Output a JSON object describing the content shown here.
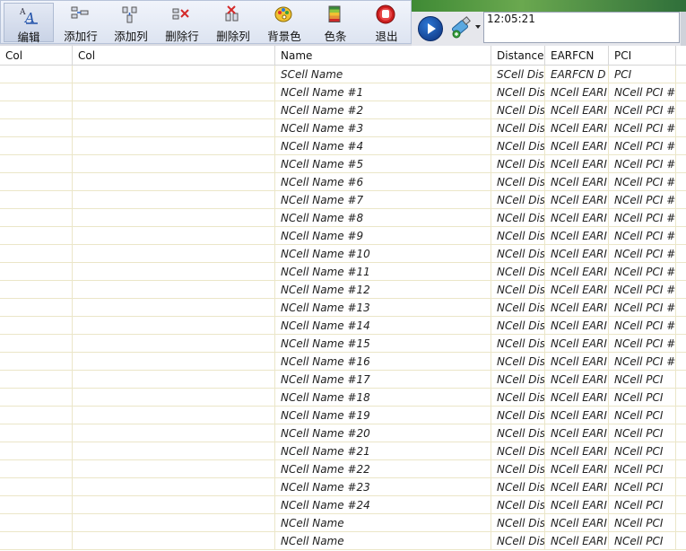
{
  "toolbar": {
    "buttons": [
      {
        "label": "编辑",
        "icon": "edit-text-icon"
      },
      {
        "label": "添加行",
        "icon": "add-row-icon"
      },
      {
        "label": "添加列",
        "icon": "add-column-icon"
      },
      {
        "label": "删除行",
        "icon": "delete-row-icon"
      },
      {
        "label": "删除列",
        "icon": "delete-column-icon"
      },
      {
        "label": "背景色",
        "icon": "palette-icon"
      },
      {
        "label": "色条",
        "icon": "color-bar-icon"
      },
      {
        "label": "退出",
        "icon": "stop-exit-icon"
      }
    ]
  },
  "status": {
    "clock": "12:05:21",
    "play_icon": "play-icon",
    "usb_icon": "usb-device-icon"
  },
  "colors": {
    "toolbar_bg": "#e4e9f4",
    "grid_line": "#ebe6c8",
    "play_blue": "#1a4fb0"
  },
  "table": {
    "headers": [
      "Col",
      "Col",
      "Name",
      "Distance",
      "EARFCN",
      "PCI"
    ],
    "rows": [
      [
        "",
        "",
        "SCell Name",
        "SCell Dis",
        "EARFCN D",
        "PCI"
      ],
      [
        "",
        "",
        "NCell Name #1",
        "NCell Dis",
        "NCell EARI",
        "NCell PCI #"
      ],
      [
        "",
        "",
        "NCell Name #2",
        "NCell Dis",
        "NCell EARI",
        "NCell PCI #"
      ],
      [
        "",
        "",
        "NCell Name #3",
        "NCell Dis",
        "NCell EARI",
        "NCell PCI #"
      ],
      [
        "",
        "",
        "NCell Name #4",
        "NCell Dis",
        "NCell EARI",
        "NCell PCI #"
      ],
      [
        "",
        "",
        "NCell Name #5",
        "NCell Dis",
        "NCell EARI",
        "NCell PCI #"
      ],
      [
        "",
        "",
        "NCell Name #6",
        "NCell Dis",
        "NCell EARI",
        "NCell PCI #"
      ],
      [
        "",
        "",
        "NCell Name #7",
        "NCell Dis",
        "NCell EARI",
        "NCell PCI #"
      ],
      [
        "",
        "",
        "NCell Name #8",
        "NCell Dis",
        "NCell EARI",
        "NCell PCI #"
      ],
      [
        "",
        "",
        "NCell Name #9",
        "NCell Dis",
        "NCell EARI",
        "NCell PCI #"
      ],
      [
        "",
        "",
        "NCell Name #10",
        "NCell Dis",
        "NCell EARI",
        "NCell PCI #"
      ],
      [
        "",
        "",
        "NCell Name #11",
        "NCell Dis",
        "NCell EARI",
        "NCell PCI #"
      ],
      [
        "",
        "",
        "NCell Name #12",
        "NCell Dis",
        "NCell EARI",
        "NCell PCI #"
      ],
      [
        "",
        "",
        "NCell Name #13",
        "NCell Dis",
        "NCell EARI",
        "NCell PCI #"
      ],
      [
        "",
        "",
        "NCell Name #14",
        "NCell Dis",
        "NCell EARI",
        "NCell PCI #"
      ],
      [
        "",
        "",
        "NCell Name #15",
        "NCell Dis",
        "NCell EARI",
        "NCell PCI #"
      ],
      [
        "",
        "",
        "NCell Name #16",
        "NCell Dis",
        "NCell EARI",
        "NCell PCI #"
      ],
      [
        "",
        "",
        "NCell Name #17",
        "NCell Dis",
        "NCell EARI",
        "NCell PCI"
      ],
      [
        "",
        "",
        "NCell Name #18",
        "NCell Dis",
        "NCell EARI",
        "NCell PCI"
      ],
      [
        "",
        "",
        "NCell Name #19",
        "NCell Dis",
        "NCell EARI",
        "NCell PCI"
      ],
      [
        "",
        "",
        "NCell Name #20",
        "NCell Dis",
        "NCell EARI",
        "NCell PCI"
      ],
      [
        "",
        "",
        "NCell Name #21",
        "NCell Dis",
        "NCell EARI",
        "NCell PCI"
      ],
      [
        "",
        "",
        "NCell Name #22",
        "NCell Dis",
        "NCell EARI",
        "NCell PCI"
      ],
      [
        "",
        "",
        "NCell Name #23",
        "NCell Dis",
        "NCell EARI",
        "NCell PCI"
      ],
      [
        "",
        "",
        "NCell Name #24",
        "NCell Dis",
        "NCell EARI",
        "NCell PCI"
      ],
      [
        "",
        "",
        "NCell Name",
        "NCell Dis",
        "NCell EARI",
        "NCell PCI"
      ],
      [
        "",
        "",
        "NCell Name",
        "NCell Dis",
        "NCell EARI",
        "NCell PCI"
      ]
    ]
  }
}
